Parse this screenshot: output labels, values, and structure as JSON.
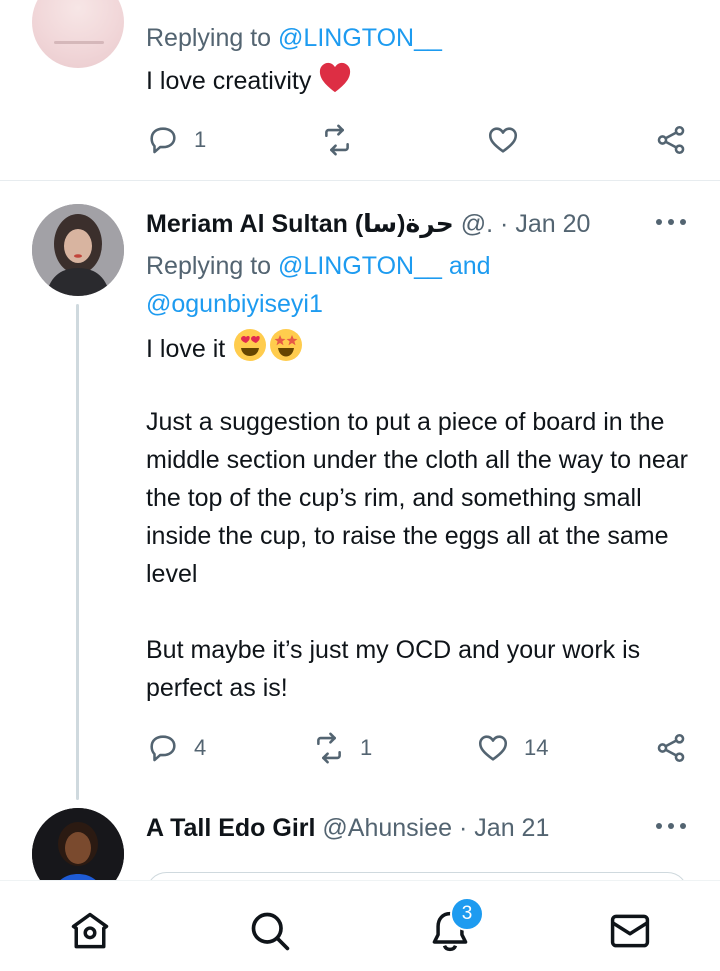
{
  "tweet_top": {
    "replying_prefix": "Replying to",
    "replying_handle": "@LINGTON__",
    "text": "I love creativity",
    "emoji": "red-heart",
    "reply_count": "1",
    "retweet_count": "",
    "like_count": ""
  },
  "tweet_meriam": {
    "name": "Meriam Al Sultan (سا)حرة",
    "handle": "@.",
    "separator": "·",
    "date": "Jan 20",
    "replying_prefix": "Replying to",
    "replying_handle_1": "@LINGTON__",
    "replying_and": "and",
    "replying_handle_2": "@ogunbiyiseyi1",
    "line_1": "I love it",
    "emojis": [
      "heart-eyes-face",
      "star-struck-face"
    ],
    "paragraph_2": "Just a suggestion to put a piece of board in the middle section under the cloth all the way to near the top of the cup’s rim, and something small inside the cup, to raise the eggs all at the same level",
    "paragraph_3": "But maybe it’s just my OCD and your work is perfect as is!",
    "reply_count": "4",
    "retweet_count": "1",
    "like_count": "14"
  },
  "tweet_edo": {
    "name": "A Tall Edo Girl",
    "handle": "@Ahunsiee",
    "separator": "·",
    "date": "Jan 21"
  },
  "bottom_nav": {
    "notification_badge": "3"
  },
  "colors": {
    "accent": "#1d9bf0",
    "text": "#0f1419",
    "muted": "#536471",
    "heart_red": "#f4212e"
  }
}
